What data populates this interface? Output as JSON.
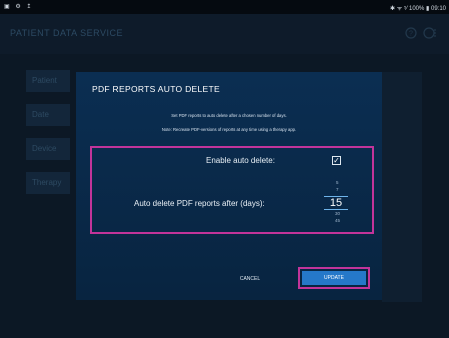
{
  "status_bar": {
    "left_icons": "▣ ⚙ ↥",
    "right_text": "✱ ᯤ ⁵⁄ 100% ▮ 09:10"
  },
  "app": {
    "title": "PATIENT DATA SERVICE",
    "help_icon": "help-circle-icon",
    "more_icon": "more-icon"
  },
  "sidebar": {
    "items": [
      {
        "label": "Patient"
      },
      {
        "label": "Date"
      },
      {
        "label": "Device"
      },
      {
        "label": "Therapy"
      }
    ]
  },
  "dialog": {
    "title": "PDF REPORTS AUTO DELETE",
    "description_1": "Set PDF reports to auto delete after a chosen number of days.",
    "description_2": "Note: Recreate PDF-versions of reports at any time using a therapy app.",
    "enable_label": "Enable auto delete:",
    "enable_checked": true,
    "days_label": "Auto delete PDF reports after (days):",
    "days_options_above": [
      "5",
      "7"
    ],
    "days_selected": "15",
    "days_options_below": [
      "30",
      "45"
    ],
    "cancel_label": "CANCEL",
    "update_label": "UPDATE",
    "accent_color": "#2578c9",
    "highlight_color": "#c2349a"
  }
}
